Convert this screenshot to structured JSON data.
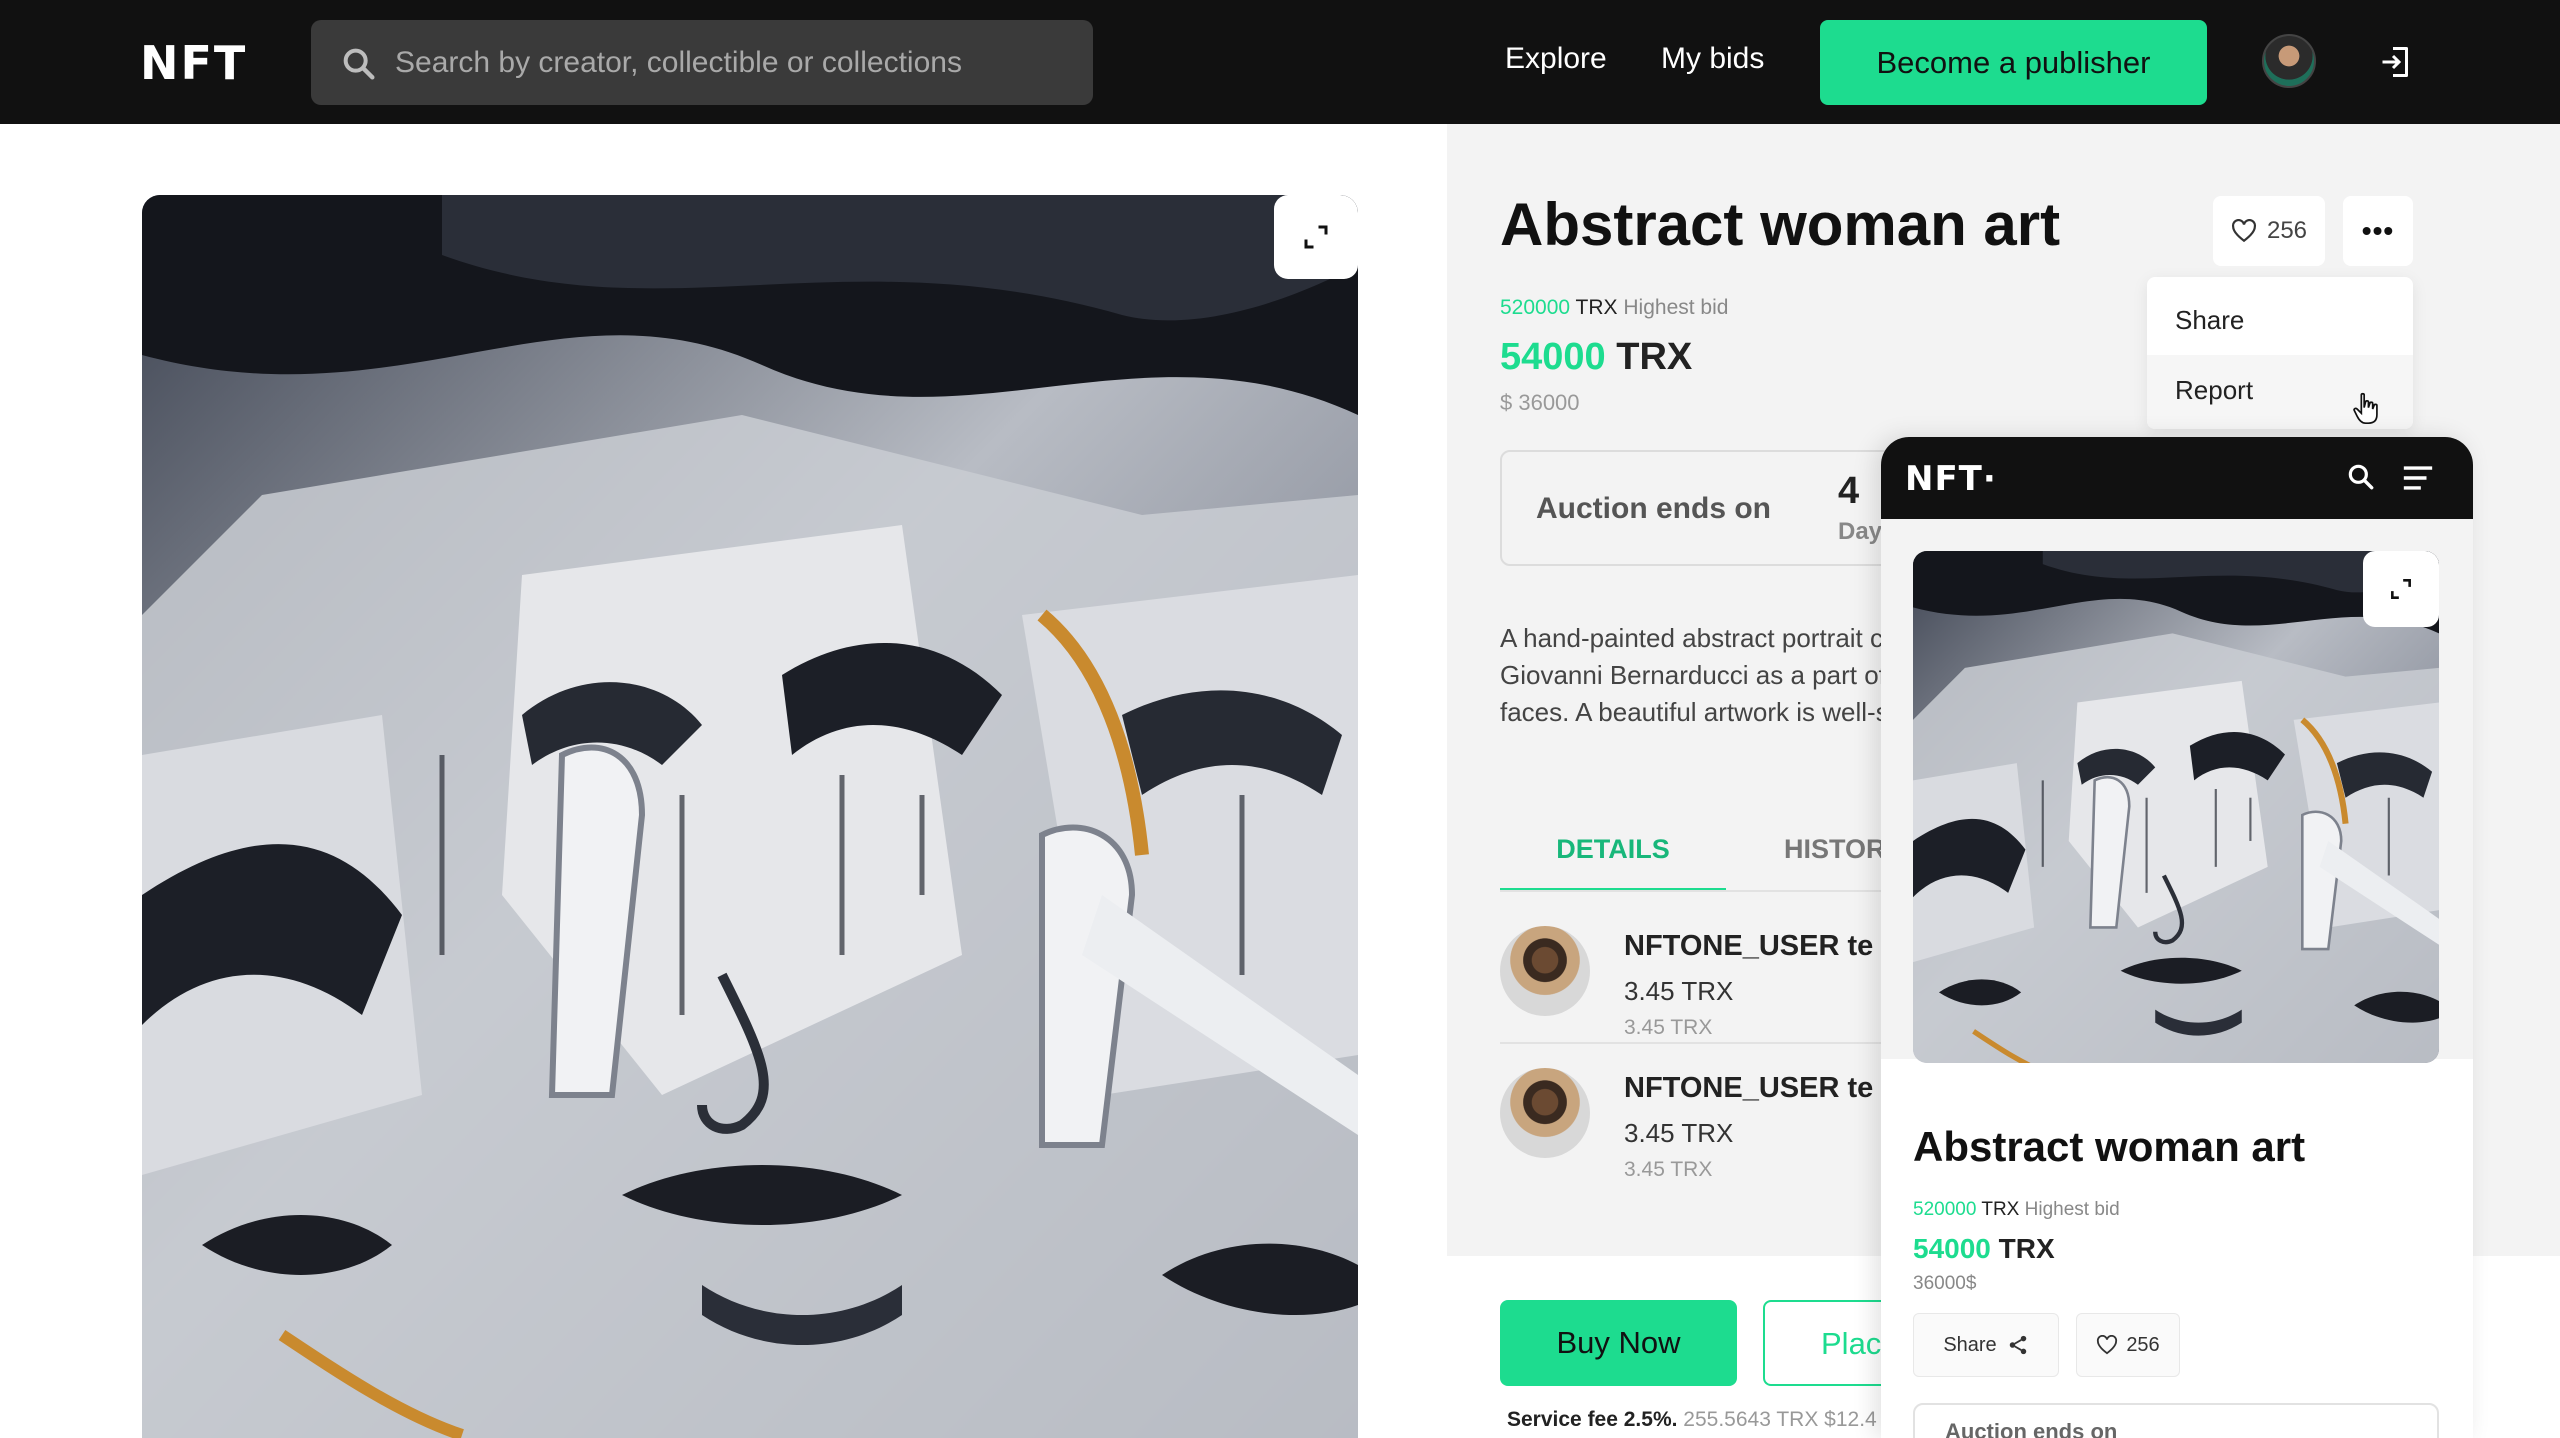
{
  "header": {
    "logo": "NFT",
    "search_placeholder": "Search by creator, collectible or collections",
    "nav": [
      "Explore",
      "My bids"
    ],
    "cta": "Become a publisher"
  },
  "item": {
    "title": "Abstract woman art",
    "likes": "256",
    "more": "•••",
    "menu": [
      "Share",
      "Report"
    ],
    "highest_bid_value": "520000",
    "highest_bid_unit": "TRX",
    "highest_bid_label": "Highest bid",
    "price_value": "54000",
    "price_unit": "TRX",
    "usd": "$ 36000",
    "auction_label": "Auction ends on",
    "auction_count": "4",
    "auction_unit": "Day",
    "description": [
      "A hand-painted abstract portrait c",
      "Giovanni Bernarducci as a part of",
      "faces. A beautiful artwork is well-s"
    ],
    "tabs": [
      "DETAILS",
      "HISTOR"
    ],
    "history": [
      {
        "name": "NFTONE_USER te",
        "amount": "3.45 TRX",
        "sub": "3.45 TRX"
      },
      {
        "name": "NFTONE_USER te",
        "amount": "3.45 TRX",
        "sub": "3.45 TRX"
      }
    ],
    "buy_label": "Buy Now",
    "place_label": "Plac",
    "fee_bold": "Service fee 2.5%.",
    "fee_rest": " 255.5643 TRX $12.4"
  },
  "mobile": {
    "logo": "NFT·",
    "title": "Abstract woman art",
    "highest_bid_value": "520000",
    "highest_bid_unit": "TRX",
    "highest_bid_label": "Highest bid",
    "price_value": "54000",
    "price_unit": "TRX",
    "usd": "36000$",
    "share_label": "Share",
    "likes": "256",
    "auction_label": "Auction ends on"
  },
  "colors": {
    "accent": "#1ddc8f",
    "topbar": "#111111",
    "panel": "#f3f3f3"
  }
}
